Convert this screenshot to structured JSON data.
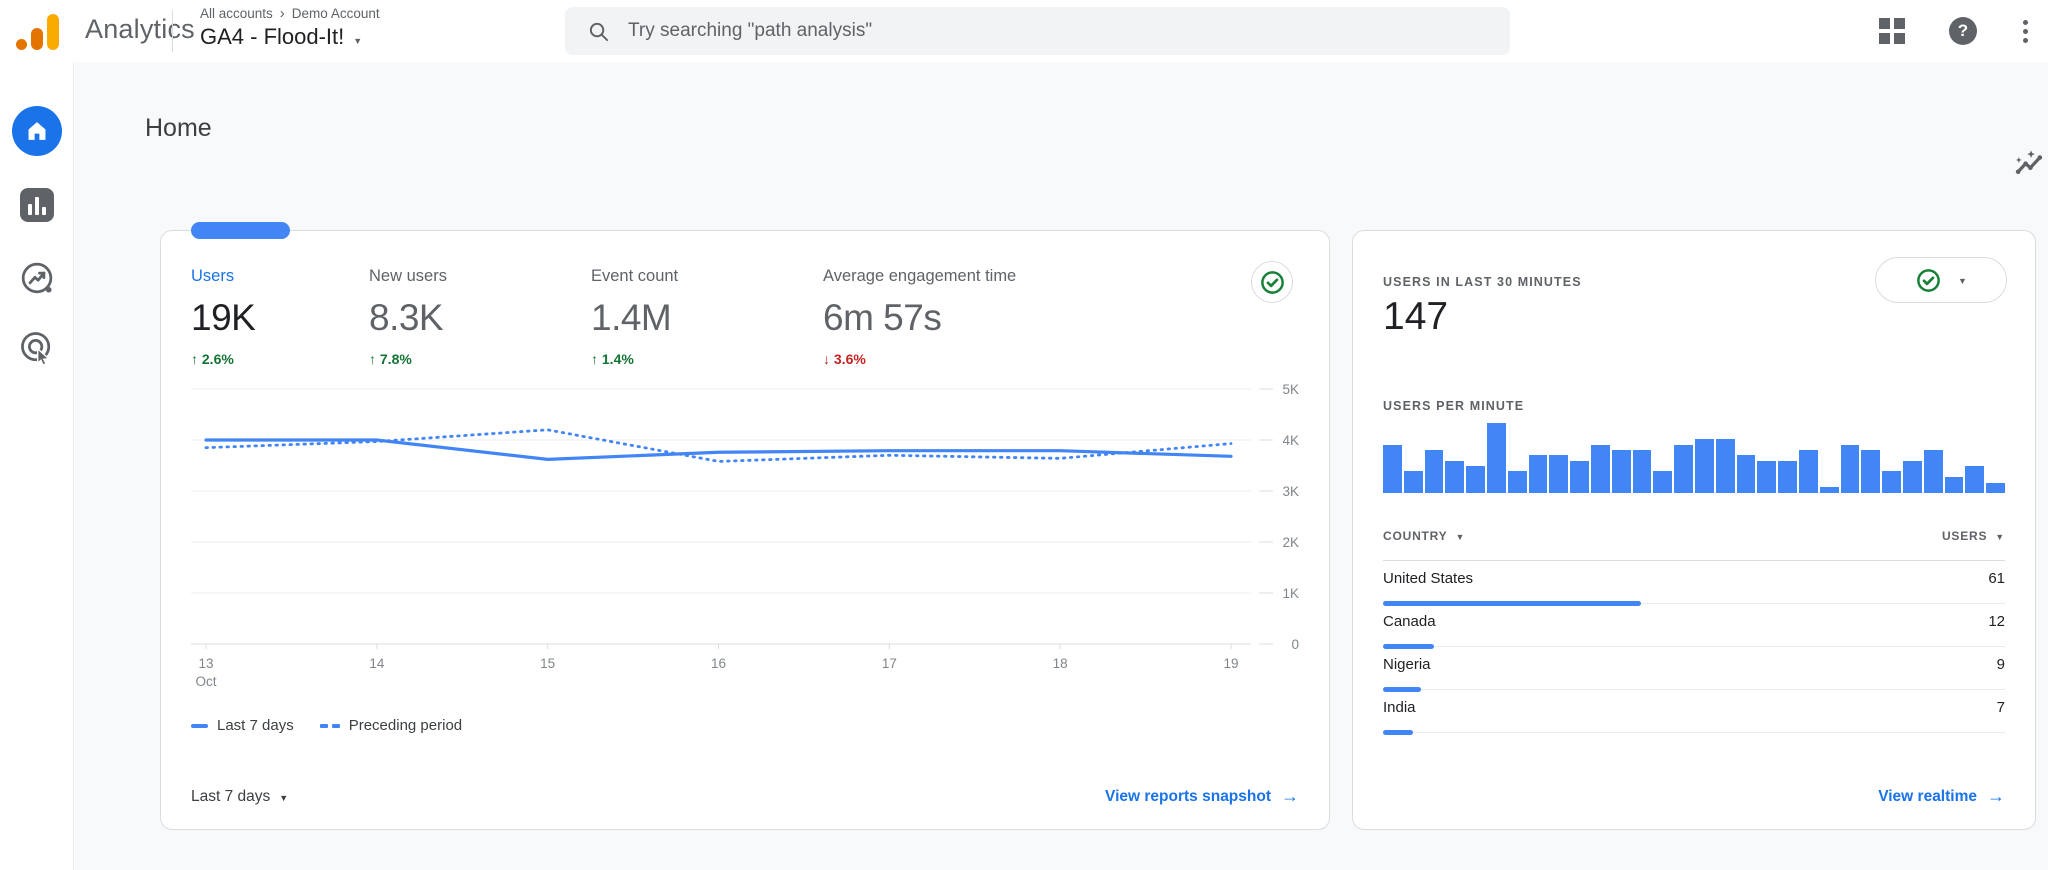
{
  "colors": {
    "accent_blue": "#4285f4",
    "link_blue": "#1a73e8",
    "positive_green": "#137333",
    "negative_red": "#c5221f",
    "logo_orange": "#e37400",
    "logo_amber": "#f9ab00"
  },
  "header": {
    "product_name": "Analytics",
    "breadcrumb": {
      "root": "All accounts",
      "account": "Demo Account"
    },
    "property_name": "GA4 - Flood-It!",
    "search": {
      "placeholder": "Try searching \"path analysis\""
    }
  },
  "sidebar": {
    "items": [
      {
        "id": "home",
        "selected": true
      },
      {
        "id": "reports",
        "selected": false
      },
      {
        "id": "explore",
        "selected": false
      },
      {
        "id": "advertising",
        "selected": false
      }
    ]
  },
  "page": {
    "title": "Home"
  },
  "overview_card": {
    "metrics": [
      {
        "label": "Users",
        "value": "19K",
        "delta": "2.6%",
        "direction": "up",
        "selected": true
      },
      {
        "label": "New users",
        "value": "8.3K",
        "delta": "7.8%",
        "direction": "up",
        "selected": false
      },
      {
        "label": "Event count",
        "value": "1.4M",
        "delta": "1.4%",
        "direction": "up",
        "selected": false
      },
      {
        "label": "Average engagement time",
        "value": "6m 57s",
        "delta": "3.6%",
        "direction": "down",
        "selected": false
      }
    ],
    "chart_data": {
      "type": "line",
      "x": [
        "13",
        "14",
        "15",
        "16",
        "17",
        "18",
        "19"
      ],
      "x_month": "Oct",
      "ylim": [
        0,
        5000
      ],
      "y_ticks": [
        "5K",
        "4K",
        "3K",
        "2K",
        "1K",
        "0"
      ],
      "grid": true,
      "series": [
        {
          "name": "Last 7 days",
          "style": "solid",
          "values": [
            4000,
            4000,
            3620,
            3760,
            3790,
            3790,
            3680
          ]
        },
        {
          "name": "Preceding period",
          "style": "dashed",
          "values": [
            3850,
            3970,
            4200,
            3580,
            3700,
            3640,
            3930
          ]
        }
      ]
    },
    "footer": {
      "range_label": "Last 7 days",
      "link_label": "View reports snapshot"
    }
  },
  "realtime_card": {
    "title": "USERS IN LAST 30 MINUTES",
    "value": "147",
    "sparkline_title": "USERS PER MINUTE",
    "chart_data": {
      "type": "bar",
      "values": [
        9,
        4,
        8,
        6,
        5,
        13,
        4,
        7,
        7,
        6,
        9,
        8,
        8,
        4,
        9,
        10,
        10,
        7,
        6,
        6,
        8,
        1,
        9,
        8,
        4,
        6,
        8,
        3,
        5,
        2
      ],
      "ymax": 13
    },
    "table": {
      "columns": [
        "COUNTRY",
        "USERS"
      ],
      "total_users": 147,
      "rows": [
        {
          "country": "United States",
          "users": 61
        },
        {
          "country": "Canada",
          "users": 12
        },
        {
          "country": "Nigeria",
          "users": 9
        },
        {
          "country": "India",
          "users": 7
        }
      ]
    },
    "link_label": "View realtime"
  }
}
